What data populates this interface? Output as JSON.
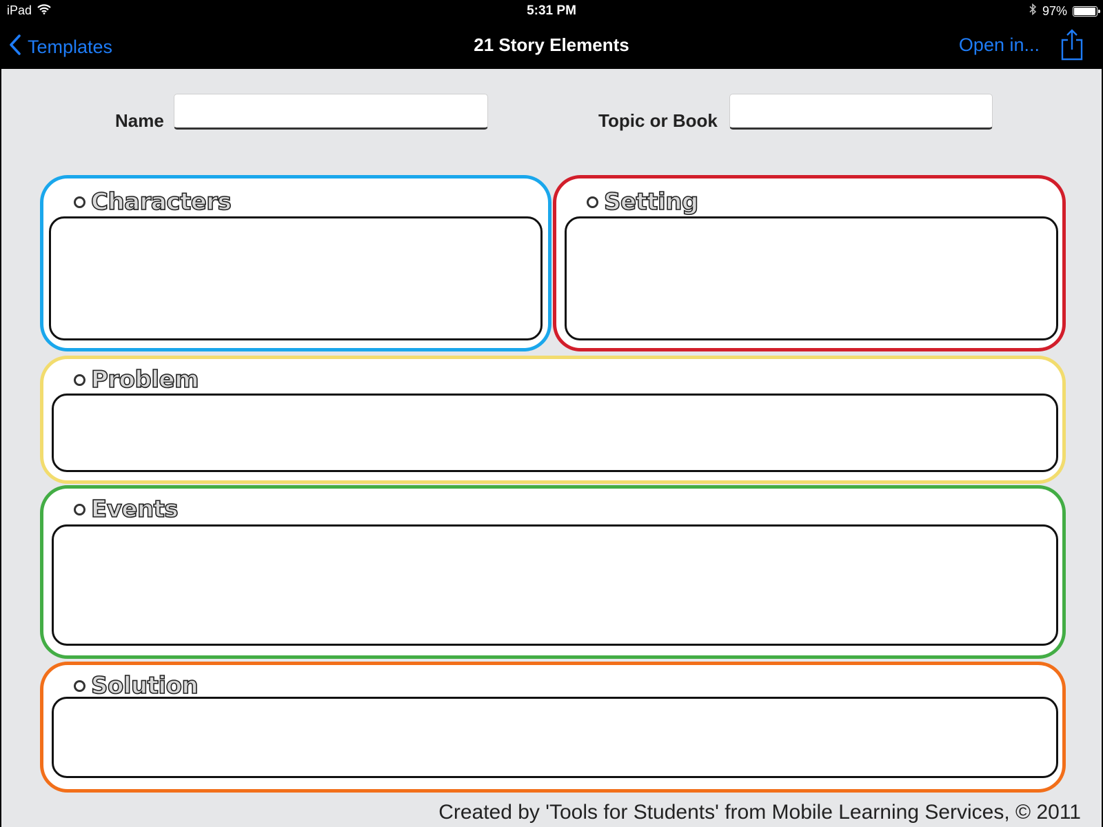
{
  "status_bar": {
    "device": "iPad",
    "time": "5:31 PM",
    "battery_percent": "97%",
    "battery_level": 0.97
  },
  "nav": {
    "back_label": "Templates",
    "title": "21 Story Elements",
    "open_in_label": "Open in..."
  },
  "form": {
    "name_label": "Name",
    "name_value": "",
    "topic_label": "Topic or Book",
    "topic_value": ""
  },
  "sections": {
    "characters": {
      "title": "Characters",
      "color": "#1aa7ec"
    },
    "setting": {
      "title": "Setting",
      "color": "#d21e2b"
    },
    "problem": {
      "title": "Problem",
      "color": "#f2dc6e"
    },
    "events": {
      "title": "Events",
      "color": "#43ad45"
    },
    "solution": {
      "title": "Solution",
      "color": "#f26f1a"
    }
  },
  "footer": {
    "credit": "Created by 'Tools for Students' from Mobile Learning Services, © 2011"
  },
  "colors": {
    "ios_blue": "#1e7cf7",
    "page_bg": "#e6e7e9"
  },
  "icons": [
    "wifi-icon",
    "bluetooth-icon",
    "battery-icon",
    "back-chevron-icon",
    "share-icon"
  ]
}
